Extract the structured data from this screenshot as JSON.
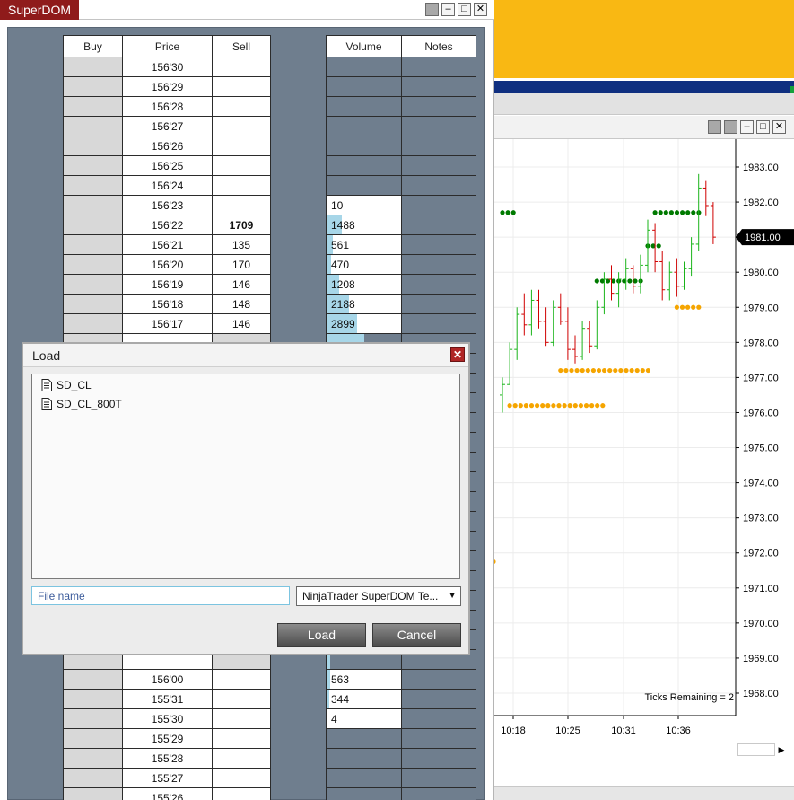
{
  "superdom": {
    "title": "SuperDOM",
    "headers": {
      "buy": "Buy",
      "price": "Price",
      "sell": "Sell",
      "volume": "Volume",
      "notes": "Notes"
    },
    "rows": [
      {
        "price": "156'30",
        "sell": "",
        "volume": "",
        "volume_fill": 0
      },
      {
        "price": "156'29",
        "sell": "",
        "volume": "",
        "volume_fill": 0
      },
      {
        "price": "156'28",
        "sell": "",
        "volume": "",
        "volume_fill": 0
      },
      {
        "price": "156'27",
        "sell": "",
        "volume": "",
        "volume_fill": 0
      },
      {
        "price": "156'26",
        "sell": "",
        "volume": "",
        "volume_fill": 0
      },
      {
        "price": "156'25",
        "sell": "",
        "volume": "",
        "volume_fill": 0
      },
      {
        "price": "156'24",
        "sell": "",
        "volume": "",
        "volume_fill": 0
      },
      {
        "price": "156'23",
        "sell": "",
        "volume": "10",
        "volume_fill": 0
      },
      {
        "price": "156'22",
        "sell": "1709",
        "sell_bold": true,
        "volume": "1488",
        "volume_fill": 0.2
      },
      {
        "price": "156'21",
        "sell": "135",
        "volume": "561",
        "volume_fill": 0.08
      },
      {
        "price": "156'20",
        "sell": "170",
        "volume": "470",
        "volume_fill": 0.06
      },
      {
        "price": "156'19",
        "sell": "146",
        "volume": "1208",
        "volume_fill": 0.17
      },
      {
        "price": "156'18",
        "sell": "148",
        "volume": "2188",
        "volume_fill": 0.3
      },
      {
        "price": "156'17",
        "sell": "146",
        "volume": "2899",
        "volume_fill": 0.4
      },
      {
        "price": "",
        "sell": "",
        "volume": "",
        "volume_fill": 0.5
      },
      {
        "price": "",
        "sell": "",
        "volume": "",
        "volume_fill": 0.5
      },
      {
        "price": "",
        "sell": "",
        "volume": "",
        "volume_fill": 0.4
      },
      {
        "price": "",
        "sell": "",
        "volume": "",
        "volume_fill": 0.3
      },
      {
        "price": "",
        "sell": "",
        "volume": "",
        "volume_fill": 0.3
      },
      {
        "price": "",
        "sell": "",
        "volume": "",
        "volume_fill": 0.25
      },
      {
        "price": "",
        "sell": "",
        "volume": "",
        "volume_fill": 0.25
      },
      {
        "price": "",
        "sell": "",
        "volume": "",
        "volume_fill": 0.2
      },
      {
        "price": "",
        "sell": "",
        "volume": "",
        "volume_fill": 0.2
      },
      {
        "price": "",
        "sell": "",
        "volume": "",
        "volume_fill": 0.15
      },
      {
        "price": "",
        "sell": "",
        "volume": "",
        "volume_fill": 0.15
      },
      {
        "price": "",
        "sell": "",
        "volume": "",
        "volume_fill": 0.12
      },
      {
        "price": "",
        "sell": "",
        "volume": "",
        "volume_fill": 0.1
      },
      {
        "price": "",
        "sell": "",
        "volume": "",
        "volume_fill": 0.1
      },
      {
        "price": "",
        "sell": "",
        "volume": "",
        "volume_fill": 0.08
      },
      {
        "price": "",
        "sell": "",
        "volume": "",
        "volume_fill": 0.06
      },
      {
        "price": "",
        "sell": "",
        "volume": "",
        "volume_fill": 0.05
      },
      {
        "price": "156'00",
        "sell": "",
        "volume": "563",
        "volume_fill": 0.05
      },
      {
        "price": "155'31",
        "sell": "",
        "volume": "344",
        "volume_fill": 0.04
      },
      {
        "price": "155'30",
        "sell": "",
        "volume": "4",
        "volume_fill": 0
      },
      {
        "price": "155'29",
        "sell": "",
        "volume": "",
        "volume_fill": 0
      },
      {
        "price": "155'28",
        "sell": "",
        "volume": "",
        "volume_fill": 0
      },
      {
        "price": "155'27",
        "sell": "",
        "volume": "",
        "volume_fill": 0
      },
      {
        "price": "155'26",
        "sell": "",
        "volume": "",
        "volume_fill": 0
      },
      {
        "price": "",
        "sell": "",
        "volume": "",
        "volume_fill": 0,
        "current": true
      }
    ],
    "colors": {
      "panel": "#6f7e8e",
      "volume_bar": "#a7d6e8",
      "title_bg": "#8f1b1b"
    }
  },
  "load_dialog": {
    "title": "Load",
    "files": [
      "SD_CL",
      "SD_CL_800T"
    ],
    "filename_value": "File name",
    "filetype_selected": "NinjaTrader SuperDOM Te...",
    "load_label": "Load",
    "cancel_label": "Cancel"
  },
  "chart": {
    "ticks_remaining": "Ticks Remaining = 2",
    "current_price_label": "1981.00",
    "chart_data": {
      "type": "line",
      "title": "",
      "xlabel": "",
      "ylabel": "",
      "x_ticks": [
        "10:18",
        "10:25",
        "10:31",
        "10:36"
      ],
      "y_ticks": [
        "1983.00",
        "1982.00",
        "1981.00",
        "1980.00",
        "1979.00",
        "1978.00",
        "1977.00",
        "1976.00",
        "1975.00",
        "1974.00",
        "1973.00",
        "1972.00",
        "1971.00",
        "1970.00",
        "1969.00",
        "1968.00"
      ],
      "ylim": [
        1967.5,
        1983.5
      ],
      "grid": true,
      "current_price": 1981.0,
      "series": [
        {
          "kind": "ohlc",
          "bars": [
            [
              1976.5,
              1977.0,
              1976.0,
              1976.8
            ],
            [
              1976.8,
              1978.0,
              1976.8,
              1977.8
            ],
            [
              1977.8,
              1979.0,
              1977.5,
              1978.8
            ],
            [
              1978.8,
              1979.4,
              1978.2,
              1978.5
            ],
            [
              1978.5,
              1979.5,
              1978.2,
              1979.2
            ],
            [
              1979.2,
              1979.5,
              1978.4,
              1978.6
            ],
            [
              1978.6,
              1979.0,
              1977.9,
              1978.0
            ],
            [
              1978.0,
              1979.2,
              1977.9,
              1979.0
            ],
            [
              1979.0,
              1979.4,
              1978.5,
              1978.6
            ],
            [
              1978.6,
              1979.0,
              1977.5,
              1977.8
            ],
            [
              1977.8,
              1978.2,
              1977.4,
              1977.6
            ],
            [
              1977.6,
              1978.6,
              1977.5,
              1978.4
            ],
            [
              1978.4,
              1978.6,
              1977.7,
              1977.9
            ],
            [
              1977.9,
              1979.2,
              1977.8,
              1979.0
            ],
            [
              1979.0,
              1980.0,
              1978.8,
              1979.8
            ],
            [
              1979.8,
              1980.2,
              1979.2,
              1979.4
            ],
            [
              1979.4,
              1980.0,
              1979.0,
              1979.8
            ],
            [
              1979.8,
              1980.4,
              1979.5,
              1980.1
            ],
            [
              1980.1,
              1980.2,
              1979.4,
              1979.6
            ],
            [
              1979.6,
              1980.5,
              1979.4,
              1980.2
            ],
            [
              1980.2,
              1981.5,
              1980.0,
              1981.2
            ],
            [
              1981.2,
              1981.4,
              1980.0,
              1980.3
            ],
            [
              1980.3,
              1980.6,
              1979.2,
              1979.5
            ],
            [
              1979.5,
              1980.3,
              1979.2,
              1980.0
            ],
            [
              1980.0,
              1980.4,
              1979.3,
              1979.6
            ],
            [
              1979.6,
              1980.3,
              1979.5,
              1980.1
            ],
            [
              1980.1,
              1981.0,
              1979.9,
              1980.8
            ],
            [
              1980.8,
              1982.8,
              1980.6,
              1982.4
            ],
            [
              1982.4,
              1982.6,
              1981.6,
              1981.9
            ],
            [
              1981.9,
              1982.0,
              1980.8,
              1981.0
            ]
          ]
        },
        {
          "name": "",
          "kind": "dots",
          "color": "#007a00",
          "segments": [
            [
              0,
              2,
              1981.7
            ],
            [
              13,
              19,
              1979.75
            ],
            [
              20,
              22,
              1980.75
            ],
            [
              21,
              27,
              1981.7
            ]
          ]
        },
        {
          "name": "",
          "kind": "dots",
          "color": "#f5a500",
          "segments": [
            [
              1,
              14,
              1976.2
            ],
            [
              8,
              20,
              1977.2
            ],
            [
              24,
              27,
              1979.0
            ]
          ]
        }
      ]
    }
  }
}
